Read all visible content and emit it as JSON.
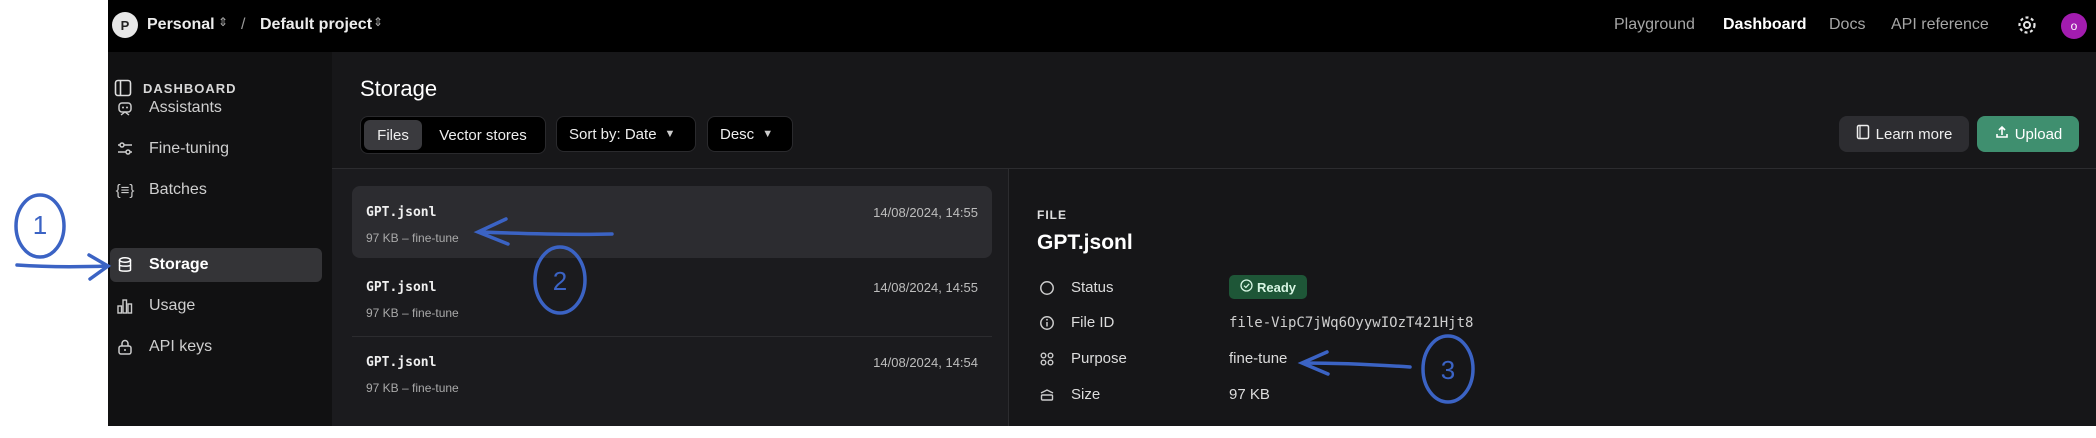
{
  "topbar": {
    "workspace_initial": "P",
    "workspace_name": "Personal",
    "separator": "/",
    "project_name": "Default project",
    "nav": [
      "Playground",
      "Dashboard",
      "Docs",
      "API reference"
    ],
    "active_nav": "Dashboard",
    "user_initial": "o"
  },
  "sidebar": {
    "title": "DASHBOARD",
    "items": [
      {
        "label": "Assistants",
        "icon": "robot-icon"
      },
      {
        "label": "Fine-tuning",
        "icon": "sliders-icon"
      },
      {
        "label": "Batches",
        "icon": "braces-list-icon"
      },
      {
        "label": "Storage",
        "icon": "database-icon",
        "active": true
      },
      {
        "label": "Usage",
        "icon": "bar-chart-icon"
      },
      {
        "label": "API keys",
        "icon": "lock-icon"
      }
    ]
  },
  "main": {
    "title": "Storage",
    "tabs": [
      "Files",
      "Vector stores"
    ],
    "active_tab": "Files",
    "sort_label": "Sort by: Date",
    "order_label": "Desc",
    "learn_more": "Learn more",
    "upload": "Upload"
  },
  "files": [
    {
      "name": "GPT.jsonl",
      "meta": "97 KB – fine-tune",
      "date": "14/08/2024, 14:55"
    },
    {
      "name": "GPT.jsonl",
      "meta": "97 KB – fine-tune",
      "date": "14/08/2024, 14:55"
    },
    {
      "name": "GPT.jsonl",
      "meta": "97 KB – fine-tune",
      "date": "14/08/2024, 14:54"
    }
  ],
  "detail": {
    "section_label": "FILE",
    "title": "GPT.jsonl",
    "status_label": "Status",
    "status_value": "Ready",
    "file_id_label": "File ID",
    "file_id_value": "file-VipC7jWq6OyywIOzT421Hjt8",
    "purpose_label": "Purpose",
    "purpose_value": "fine-tune",
    "size_label": "Size",
    "size_value": "97 KB"
  },
  "annotations": [
    "1",
    "2",
    "3"
  ],
  "colors": {
    "accent_green": "#3f8f6f",
    "annotation_blue": "#3b63c4",
    "ready_badge": "#1e5637"
  }
}
